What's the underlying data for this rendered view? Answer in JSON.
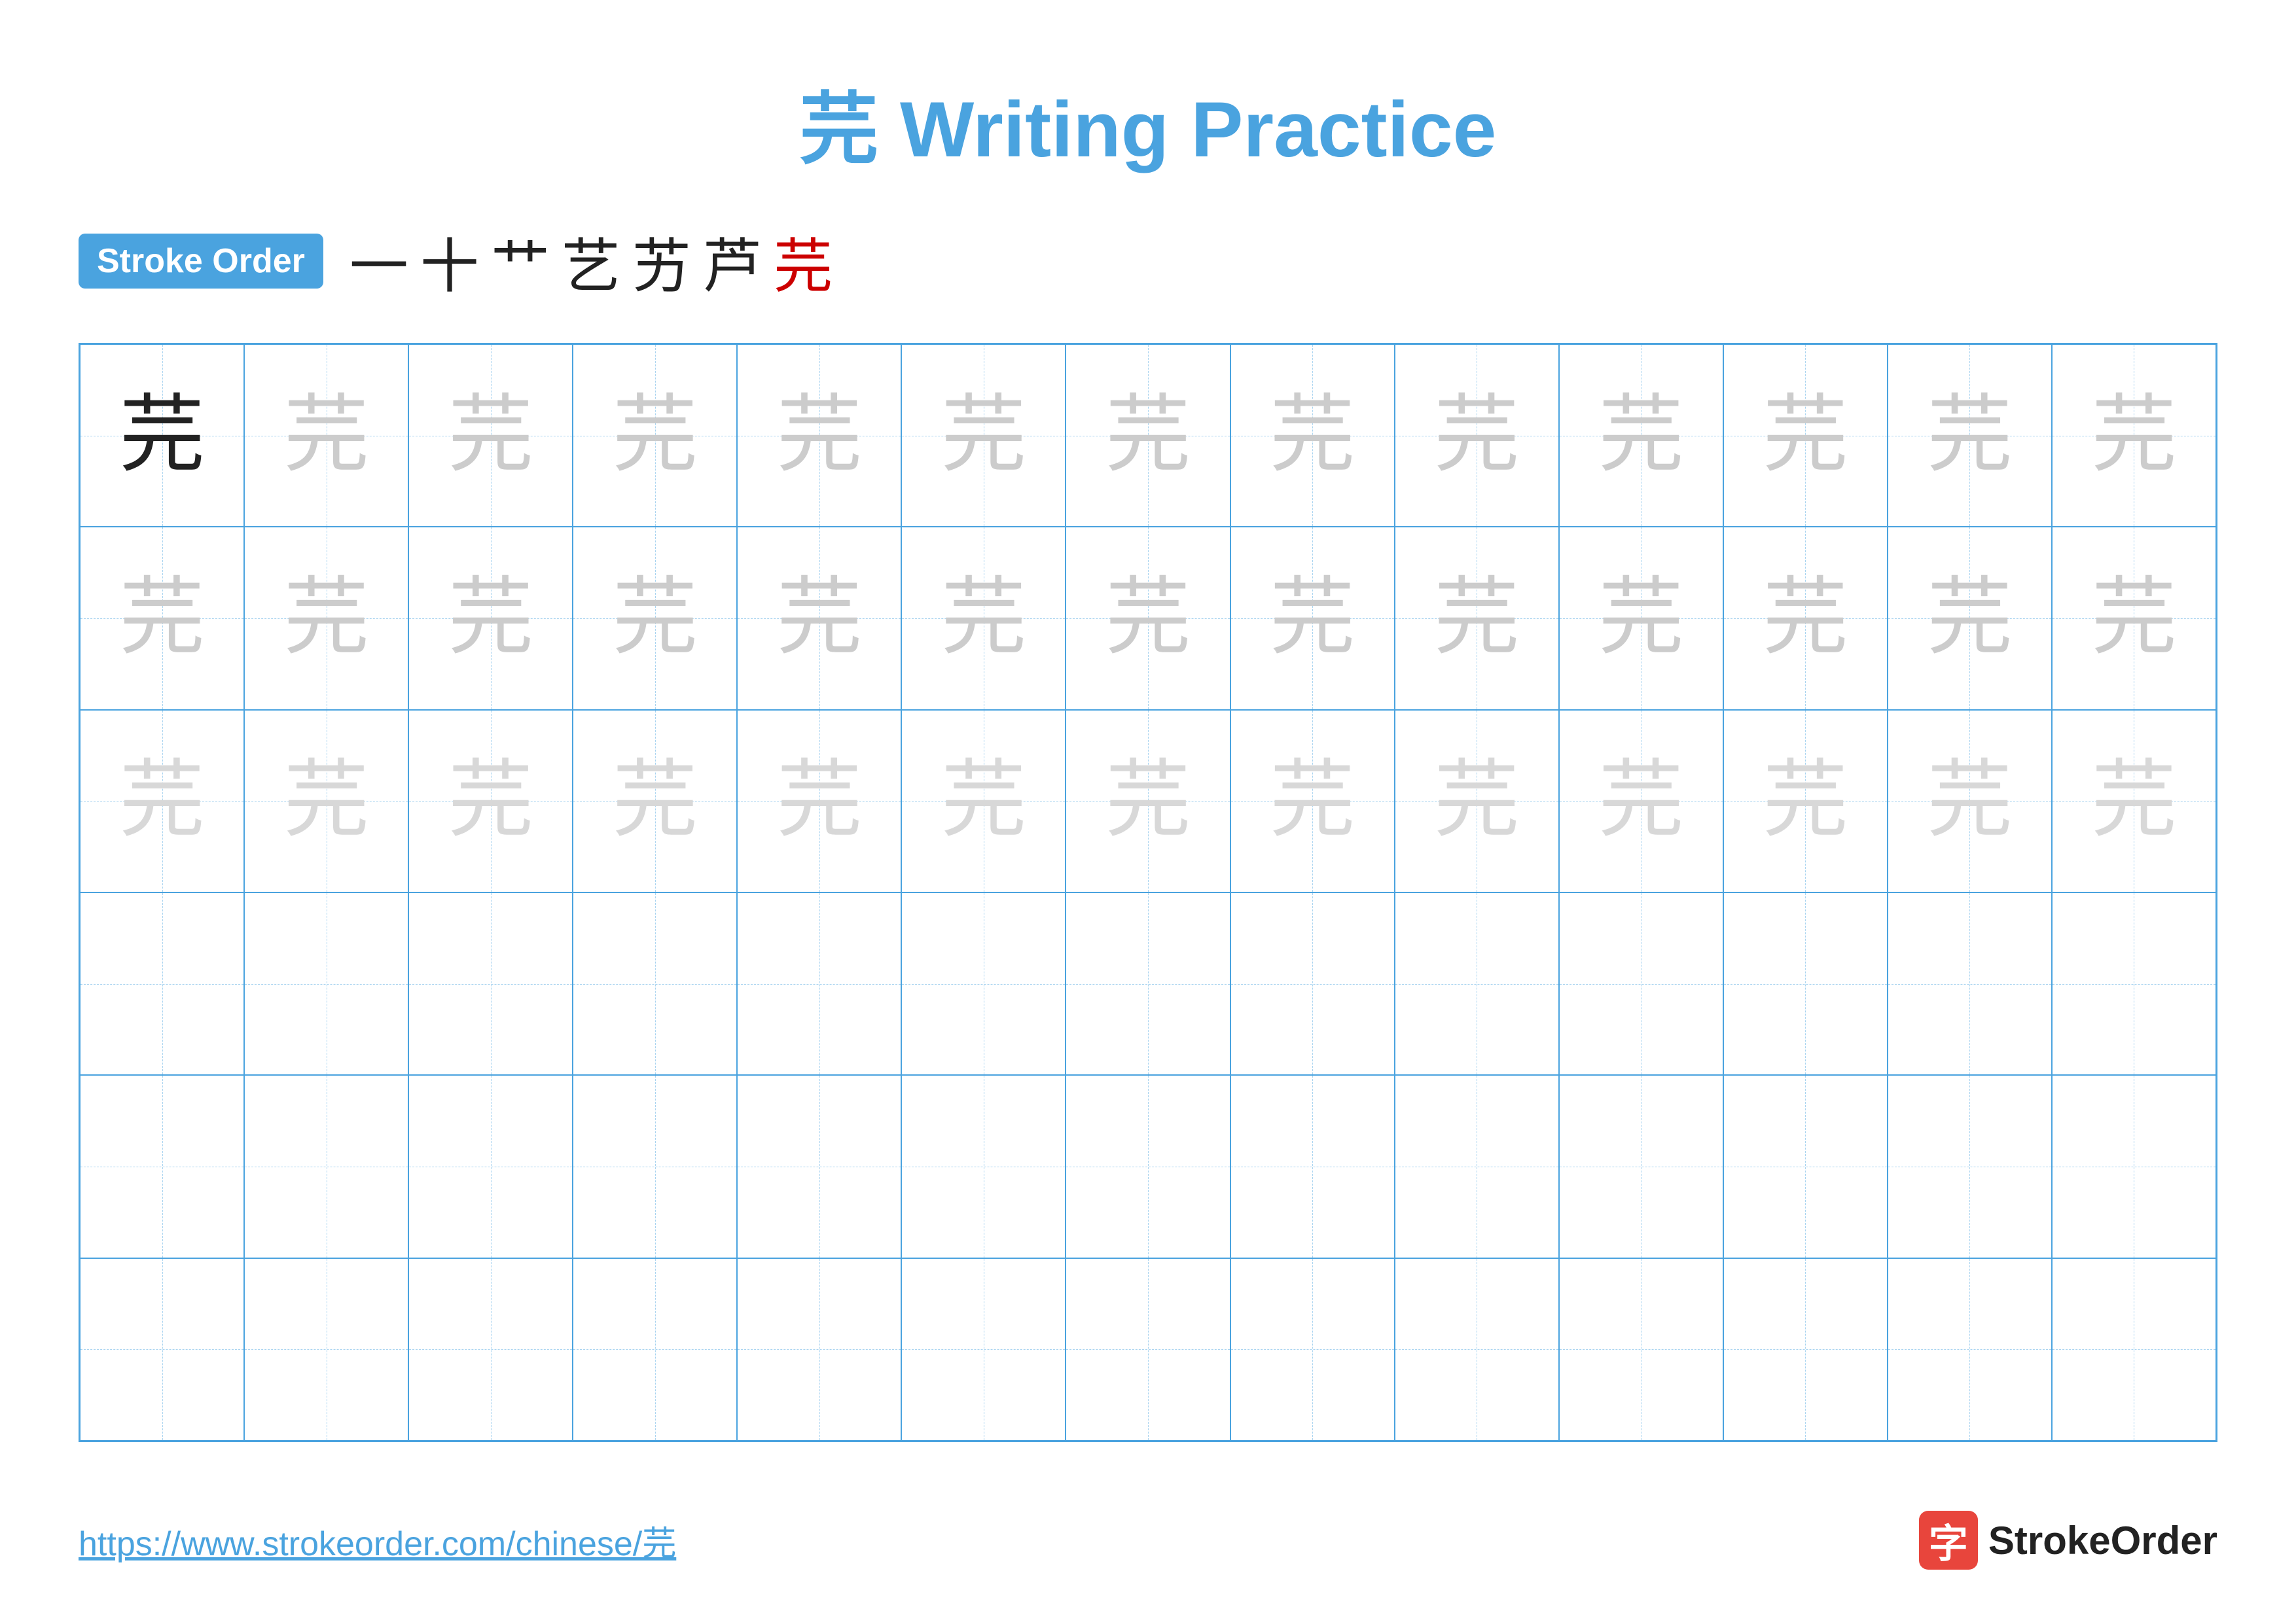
{
  "title": {
    "chinese_char": "芫",
    "rest": " Writing Practice"
  },
  "stroke_order": {
    "badge_label": "Stroke Order",
    "strokes": [
      "一",
      "十",
      "艹",
      "艺",
      "艻",
      "芦",
      "芫"
    ]
  },
  "grid": {
    "cols": 13,
    "rows": 6,
    "char": "芫",
    "row1_type": "solid_then_light",
    "row2_type": "light",
    "row3_type": "lighter",
    "rows456_type": "empty"
  },
  "footer": {
    "url": "https://www.strokeorder.com/chinese/芫",
    "logo_icon": "字",
    "logo_text": "StrokeOrder"
  }
}
